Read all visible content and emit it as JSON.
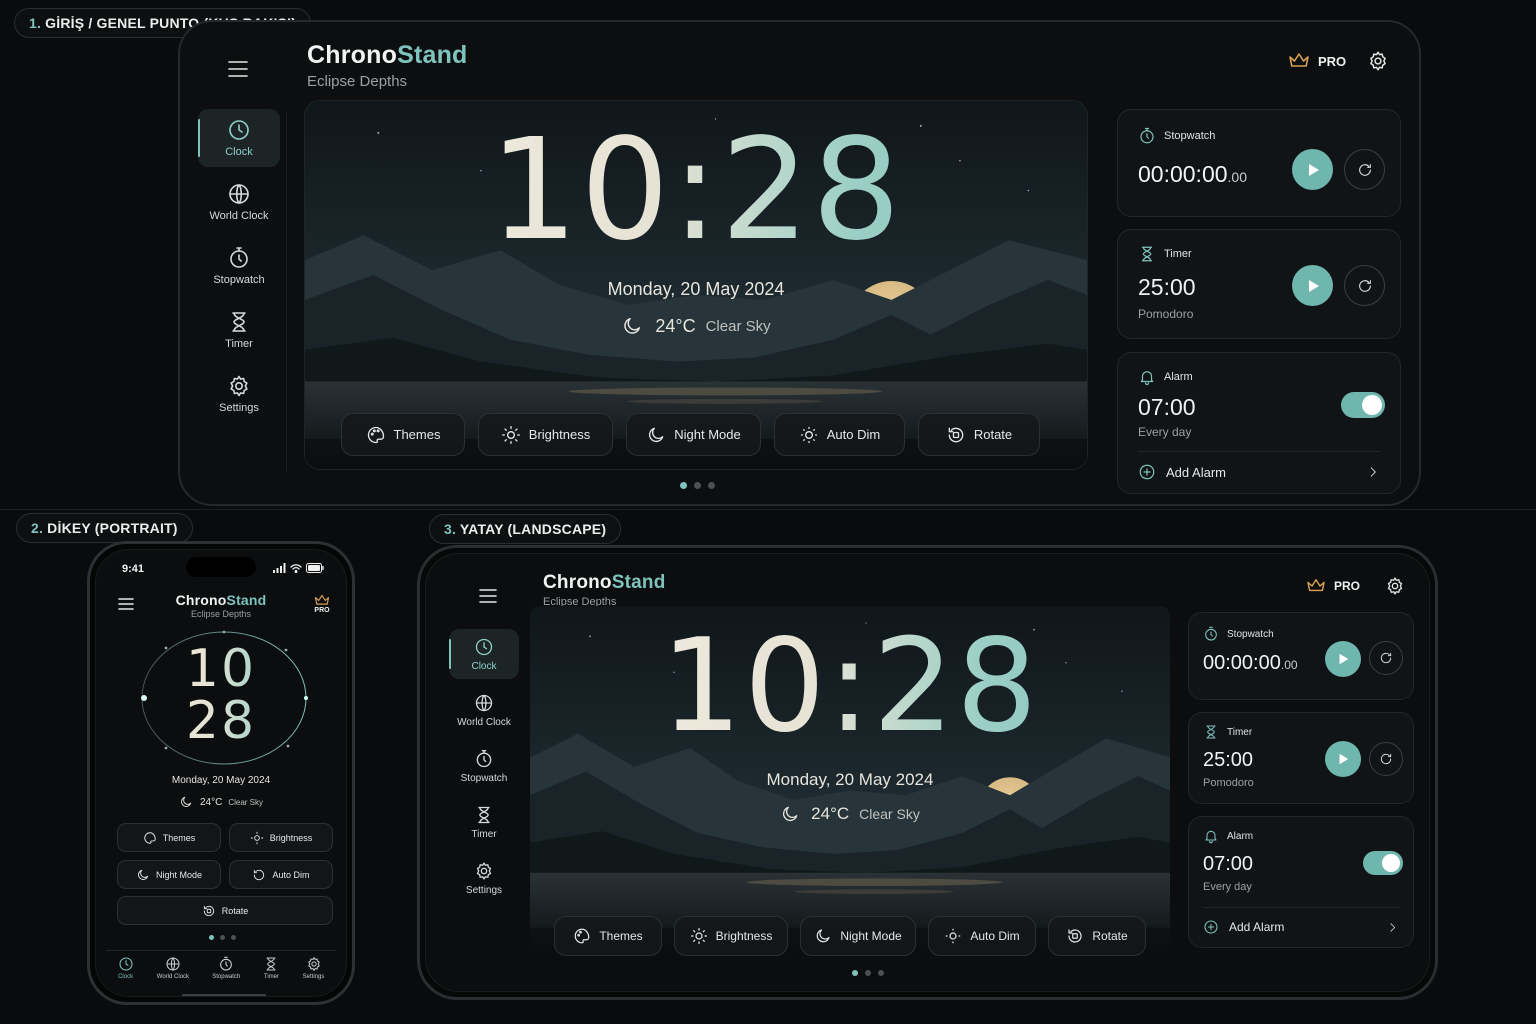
{
  "sections": {
    "overview": {
      "num": "1.",
      "label": "GİRİŞ / GENEL PUNTO (KUŞ BAKIŞI)"
    },
    "portrait": {
      "num": "2.",
      "label": "DİKEY (PORTRAIT)"
    },
    "landscape": {
      "num": "3.",
      "label": "YATAY (LANDSCAPE)"
    }
  },
  "app": {
    "brand_a": "Chrono",
    "brand_b": "Stand",
    "subtitle": "Eclipse Depths",
    "pro_label": "PRO"
  },
  "nav": [
    {
      "label": "Clock",
      "icon": "clock-icon"
    },
    {
      "label": "World Clock",
      "icon": "globe-icon"
    },
    {
      "label": "Stopwatch",
      "icon": "stopwatch-icon"
    },
    {
      "label": "Timer",
      "icon": "hourglass-icon"
    },
    {
      "label": "Settings",
      "icon": "gear-icon"
    }
  ],
  "clock": {
    "time": "10:28",
    "hours": "10",
    "minutes": "28",
    "date": "Monday, 20 May 2024",
    "temp": "24°C",
    "condition": "Clear Sky"
  },
  "actions": [
    {
      "label": "Themes",
      "icon": "palette-icon"
    },
    {
      "label": "Brightness",
      "icon": "sun-icon"
    },
    {
      "label": "Night Mode",
      "icon": "moon-icon"
    },
    {
      "label": "Auto Dim",
      "icon": "sun-dim-icon"
    },
    {
      "label": "Rotate",
      "icon": "rotate-icon"
    }
  ],
  "stopwatch": {
    "title": "Stopwatch",
    "value": "00:00:00",
    "fraction": ".00"
  },
  "timer": {
    "title": "Timer",
    "value": "25:00",
    "sub": "Pomodoro"
  },
  "alarm": {
    "title": "Alarm",
    "value": "07:00",
    "sub": "Every day",
    "enabled": true,
    "add_label": "Add Alarm"
  },
  "phone": {
    "status_time": "9:41"
  },
  "page_dots": {
    "count": 3,
    "active": 0
  },
  "colors": {
    "accent": "#7fc3bd",
    "pro": "#d9a056",
    "background": "#0a0b0c"
  }
}
